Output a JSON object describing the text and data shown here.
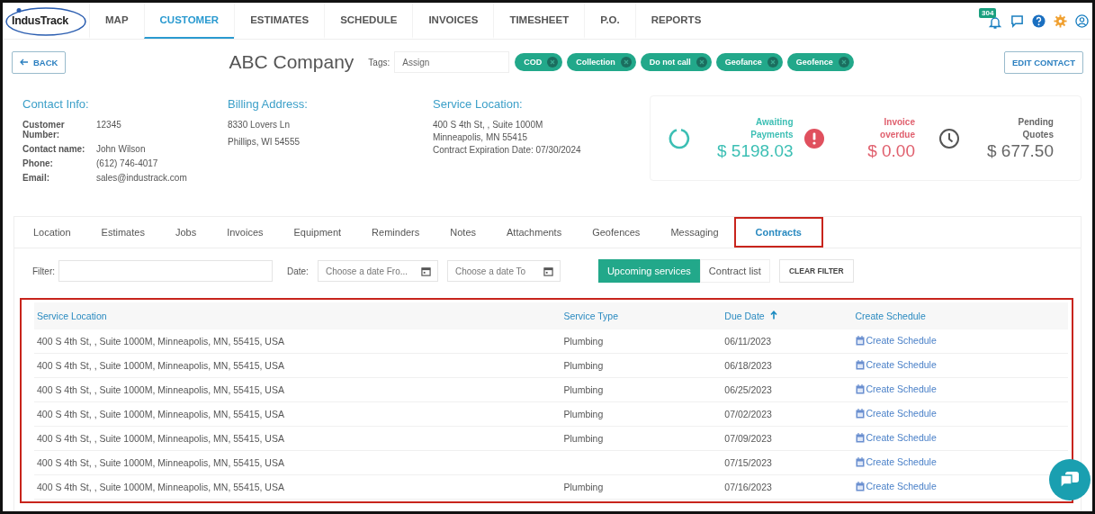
{
  "nav": {
    "logo": "IndusTrack",
    "items": [
      {
        "label": "MAP",
        "selected": false
      },
      {
        "label": "CUSTOMER",
        "selected": true
      },
      {
        "label": "ESTIMATES",
        "selected": false
      },
      {
        "label": "SCHEDULE",
        "selected": false
      },
      {
        "label": "INVOICES",
        "selected": false
      },
      {
        "label": "TIMESHEET",
        "selected": false
      },
      {
        "label": "P.O.",
        "selected": false
      },
      {
        "label": "REPORTS",
        "selected": false
      }
    ],
    "notification_count": "304"
  },
  "header": {
    "back": "BACK",
    "company": "ABC Company",
    "tags_label": "Tags:",
    "tags_placeholder": "Assign",
    "tags": [
      "COD",
      "Collection",
      "Do not call",
      "Geofance",
      "Geofence"
    ],
    "edit": "EDIT CONTACT"
  },
  "contact": {
    "title": "Contact Info:",
    "fields": [
      {
        "label": "Customer Number:",
        "value": "12345"
      },
      {
        "label": "Contact name:",
        "value": "John Wilson"
      },
      {
        "label": "Phone:",
        "value": "(612) 746-4017"
      },
      {
        "label": "Email:",
        "value": "sales@industrack.com"
      }
    ]
  },
  "billing": {
    "title": "Billing Address:",
    "lines": [
      "8330 Lovers Ln",
      "Phillips, WI 54555"
    ]
  },
  "service": {
    "title": "Service Location:",
    "lines": [
      "400 S 4th St, , Suite 1000M",
      "Minneapolis, MN 55415",
      "Contract Expiration Date: 07/30/2024"
    ]
  },
  "stats": [
    {
      "kind": "awaiting",
      "label": "Awaiting Payments",
      "value": "$ 5198.03"
    },
    {
      "kind": "overdue",
      "label": "Invoice overdue",
      "value": "$ 0.00"
    },
    {
      "kind": "pending",
      "label": "Pending Quotes",
      "value": "$ 677.50"
    }
  ],
  "tabs": [
    {
      "label": "Location",
      "selected": false
    },
    {
      "label": "Estimates",
      "selected": false
    },
    {
      "label": "Jobs",
      "selected": false
    },
    {
      "label": "Invoices",
      "selected": false
    },
    {
      "label": "Equipment",
      "selected": false
    },
    {
      "label": "Reminders",
      "selected": false
    },
    {
      "label": "Notes",
      "selected": false
    },
    {
      "label": "Attachments",
      "selected": false
    },
    {
      "label": "Geofences",
      "selected": false
    },
    {
      "label": "Messaging",
      "selected": false
    },
    {
      "label": "Contracts",
      "selected": true,
      "highlighted": true
    }
  ],
  "filters": {
    "filter_label": "Filter:",
    "date_label": "Date:",
    "date_from_placeholder": "Choose a date Fro...",
    "date_to_placeholder": "Choose a date To",
    "views": [
      {
        "label": "Upcoming services",
        "selected": true
      },
      {
        "label": "Contract list",
        "selected": false
      }
    ],
    "clear": "CLEAR FILTER"
  },
  "table": {
    "highlighted": true,
    "columns": [
      "Service Location",
      "Service Type",
      "Due Date",
      "Create Schedule"
    ],
    "rows": [
      {
        "location": "400 S 4th St, , Suite 1000M, Minneapolis, MN, 55415, USA",
        "type": "Plumbing",
        "due": "06/11/2023",
        "action": "Create Schedule"
      },
      {
        "location": "400 S 4th St, , Suite 1000M, Minneapolis, MN, 55415, USA",
        "type": "Plumbing",
        "due": "06/18/2023",
        "action": "Create Schedule"
      },
      {
        "location": "400 S 4th St, , Suite 1000M, Minneapolis, MN, 55415, USA",
        "type": "Plumbing",
        "due": "06/25/2023",
        "action": "Create Schedule"
      },
      {
        "location": "400 S 4th St, , Suite 1000M, Minneapolis, MN, 55415, USA",
        "type": "Plumbing",
        "due": "07/02/2023",
        "action": "Create Schedule"
      },
      {
        "location": "400 S 4th St, , Suite 1000M, Minneapolis, MN, 55415, USA",
        "type": "Plumbing",
        "due": "07/09/2023",
        "action": "Create Schedule"
      },
      {
        "location": "400 S 4th St, , Suite 1000M, Minneapolis, MN, 55415, USA",
        "due": "07/15/2023",
        "action": "Create Schedule"
      },
      {
        "location": "400 S 4th St, , Suite 1000M, Minneapolis, MN, 55415, USA",
        "type": "Plumbing",
        "due": "07/16/2023",
        "action": "Create Schedule"
      }
    ]
  }
}
